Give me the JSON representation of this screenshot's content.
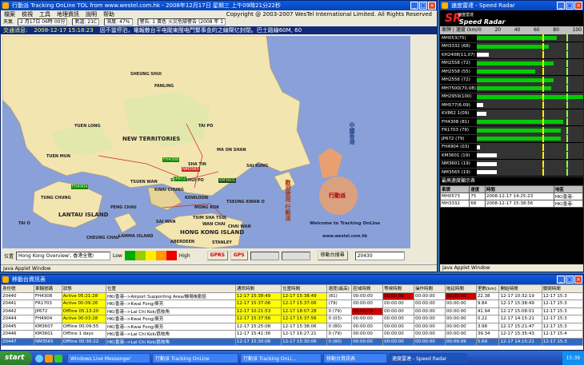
{
  "main_window": {
    "title": "行動派 Tracking OnLine TOL from www.westel.com.hk - 2008年12月17日 星期三 上午09時21分22秒",
    "menu": [
      "檔案",
      "檢視",
      "工具",
      "地理資訊",
      "說明",
      "帮助"
    ],
    "copyright": "Copyright @ 2003-2007 WesTel International Limited. All Rights Reserved",
    "info": {
      "weather_label": "天氣",
      "weather_date": "2 月17日 06時 00分",
      "temp": "氣溫: 21C",
      "humidity": "濕度: 47%",
      "warning": "警告: 1 黃色 火災危險警告 (2008 年 1"
    },
    "ticker": {
      "label": "交通消息:",
      "time": "2008-12-17 15:18:23",
      "text": "因不當停泊，電報散台平电闖東閩电門繫事金的之線閘亿封閉。巴士路線60M, 60"
    },
    "map_places": [
      "NEW TERRITORIES",
      "KOWLOON",
      "LANTAU ISLAND",
      "HONG KONG ISLAND",
      "TSUEN WAN",
      "SHA TIN",
      "TUEN MUN",
      "YUEN LONG",
      "TAI PO",
      "SAI KUNG",
      "TUNG CHUNG",
      "ABERDEEN",
      "STANLEY",
      "CHAI WAN",
      "KWAI CHUNG",
      "TSEUNG KWAN O",
      "MA ON SHAN",
      "FANLING",
      "SHEUNG SHUI",
      "LAMMA ISLAND",
      "CHEUNG CHAU",
      "PENG CHAU",
      "TAI O",
      "SAI WAN",
      "MONG KOK",
      "SHAM SHUI PO",
      "TSIM SHA TSUI",
      "WAN CHAI"
    ],
    "vehicles": [
      {
        "id": "FH4308",
        "color": "vgreen"
      },
      {
        "id": "NM3565",
        "color": "vred"
      },
      {
        "id": "KM3601",
        "color": "vdark"
      },
      {
        "id": "FH4904",
        "color": "vgreen"
      },
      {
        "id": "JP672",
        "color": "vgreen"
      }
    ],
    "welcome": {
      "cn": "歡迎使用 行動派",
      "en": "Welcome to Tracking OnLine",
      "url": "www.westel.com.hk",
      "badge": "行動派",
      "side": "中國香港"
    },
    "bottom": {
      "location_label": "位置",
      "location_value": "Hong Kong Overview', 香港全覽/",
      "low": "Low",
      "high": "High",
      "legend_colors": [
        "#00aa00",
        "#99cc00",
        "#ffee00",
        "#ff9900",
        "#ee0000"
      ],
      "gprs": "GPRS",
      "gps": "GPS",
      "move_button": "移動台搜尋",
      "count_value": "20430"
    },
    "status": "Java Applet Window"
  },
  "radar_window": {
    "title": "速度雷達 - Speed Radar",
    "logo_cn": "速度雷達",
    "logo_sr": "SR",
    "logo_en": "Speed Radar",
    "scale_label": "車牌 | 速度 (km/h)",
    "scale_ticks": [
      "0",
      "20",
      "40",
      "60",
      "80",
      "100"
    ],
    "rows": [
      {
        "label": "MH053(75)",
        "speed": 75,
        "color": "#00cc00"
      },
      {
        "label": "MH3332 (68)",
        "speed": 68,
        "color": "#00cc00"
      },
      {
        "label": "KH2408(11,07)",
        "speed": 11,
        "color": "#ffffff"
      },
      {
        "label": "MH2558 (72)",
        "speed": 72,
        "color": "#00cc00"
      },
      {
        "label": "MH2558 (55)",
        "speed": 55,
        "color": "#00cc00"
      },
      {
        "label": "MH2556 (72)",
        "speed": 72,
        "color": "#00cc00"
      },
      {
        "label": "MH7500(70,08)",
        "speed": 70,
        "color": "#00cc00"
      },
      {
        "label": "MH2959(100)",
        "speed": 100,
        "color": "#00cc00"
      },
      {
        "label": "MH577(6.09)",
        "speed": 6,
        "color": "#ffffff"
      },
      {
        "label": "KV862 1(09)",
        "speed": 9,
        "color": "#ffffff"
      },
      {
        "label": "FH4308 (81)",
        "speed": 81,
        "color": "#00cc00"
      },
      {
        "label": "FR1703 (79)",
        "speed": 79,
        "color": "#00cc00"
      },
      {
        "label": "JP672 (79)",
        "speed": 79,
        "color": "#00cc00"
      },
      {
        "label": "FH4904 (03)",
        "speed": 3,
        "color": "#ffffff"
      },
      {
        "label": "KM3601 (19)",
        "speed": 19,
        "color": "#ffffff"
      },
      {
        "label": "NM3601 (19)",
        "speed": 19,
        "color": "#ffffff"
      },
      {
        "label": "NM3565 (19)",
        "speed": 19,
        "color": "#ffffff"
      }
    ],
    "highest_title": "最高速度顯示表",
    "highest_cols": [
      "車牌",
      "速度",
      "時間",
      "地區"
    ],
    "highest_rows": [
      [
        "MH0573",
        "75",
        "2008-12-17 14:25:23",
        "HK(香港-"
      ],
      [
        "MH3332",
        "68",
        "2008-12-17 15:38:56",
        "HK(香港-"
      ]
    ],
    "status": "Java Applet Window"
  },
  "table_window": {
    "title": "移動台資訊表",
    "columns": [
      "身份號",
      "車輛號碼",
      "狀態",
      "位置",
      "通訊時間",
      "位置時間",
      "速度(最高)",
      "區域時間",
      "等候時間",
      "操作時間",
      "拖延時間",
      "里數(km)",
      "開始時間",
      "關閉時間"
    ],
    "rows": [
      [
        "20440",
        "FH4308",
        "Active 05:21:28",
        "HK(香港-->Airport Supporting Area/機場後勤區",
        "12-17 15:38:49",
        "12-17 15:38:49",
        "(81)",
        "00:00:00",
        "00:00:00",
        "00:00:00",
        "00:00:00",
        "22.38",
        "12-17 10:32:19",
        "12-17 15:3"
      ],
      [
        "20441",
        "FR1703",
        "Active 00:09:26",
        "HK(香港-->Kwai Fong/葵芳",
        "12-17 15:37:06",
        "12-17 15:37:06",
        "(79)",
        "00:00:00",
        "00:00:00",
        "00:00:00",
        "00:00:00",
        "9.84",
        "12-17 15:38:49",
        "12-17 15:3"
      ],
      [
        "20442",
        "JP672",
        "Offline 05:13:20",
        "HK(香港-->Lai Chi Kok/荔枝角",
        "12-17 10:21:53",
        "12-17 18:07:28",
        "0 (79)",
        "00:00:00",
        "00:00:00",
        "00:00:00",
        "00:00:00",
        "41.94",
        "12-17 15:08:01",
        "12-17 15:3"
      ],
      [
        "20444",
        "FH4904",
        "Active 00:03:28",
        "HK(香港-->Kwai Fong/葵芳",
        "12-17 15:37:56",
        "12-17 15:37:56",
        "0 (03)",
        "00:00:00",
        "00:00:00",
        "00:00:00",
        "00:00:00",
        "0.22",
        "12-17 14:15:21",
        "12-17 15:3"
      ],
      [
        "20445",
        "KM3607",
        "Offline 00:09:55",
        "HK(香港-->Kwai Fong/葵芳",
        "12-17 15:25:08",
        "12-17 15:38:06",
        "0 (80)",
        "00:00:00",
        "00:00:00",
        "00:00:00",
        "00:00:00",
        "3.98",
        "12-17 15:21:47",
        "12-17 15:3"
      ],
      [
        "20446",
        "KM3601",
        "Offline 1 days",
        "HK(香港-->Lai Chi Kok/荔枝角",
        "12-17 15:41:36",
        "12-17 16:27:21",
        "0 (79)",
        "00:00:00",
        "00:00:00",
        "00:00:00",
        "00:00:00",
        "39.34",
        "12-17 15:35:43",
        "12-17 15:4"
      ],
      [
        "20447",
        "NM3565",
        "Offline 00:30:22",
        "HK(香港-->Lai Chi Kok/荔枝角",
        "12-17 15:30:06",
        "12-17 15:30:06",
        "0 (80)",
        "00:00:00",
        "00:00:00",
        "00:00:00",
        "00:09:09",
        "5.69",
        "12-17 14:15:21",
        "12-17 15:3"
      ]
    ],
    "row_styles": [
      "yellow",
      "yellow",
      "orange",
      "yellow",
      "white",
      "white",
      "selected"
    ]
  },
  "taskbar": {
    "start": "start",
    "items": [
      "Windows Live Messenger",
      "行動派 Tracking OnLine",
      "行動派 Tracking OnLi...",
      "移動台資訊表",
      "速度雷達 - Speed Radar"
    ],
    "clock": "15:39"
  }
}
